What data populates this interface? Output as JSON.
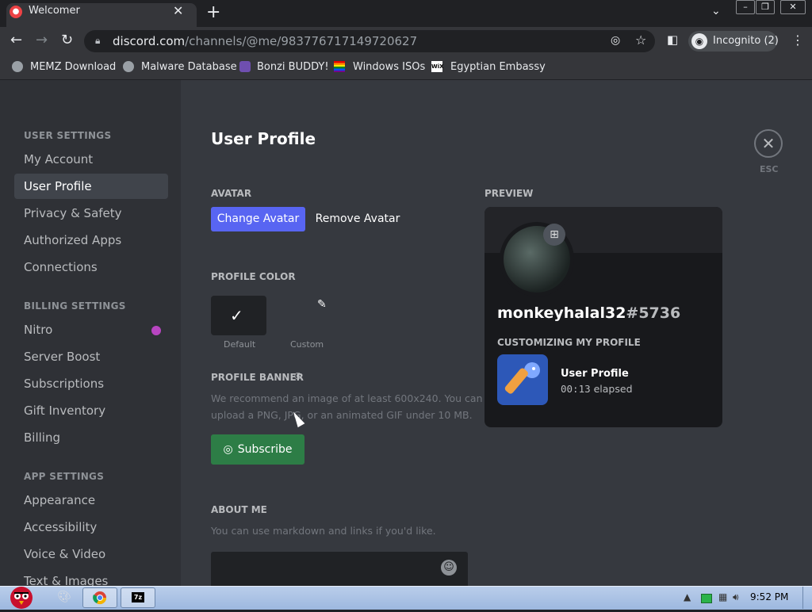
{
  "browser": {
    "tab_title": "Welcomer",
    "tab_close": "✕",
    "new_tab": "+",
    "url_host": "discord.com",
    "url_path": "/channels/@me/983776717149720627",
    "incognito_label": "Incognito (2)",
    "bookmarks": [
      {
        "label": "MEMZ Download",
        "icon": "globe-icon"
      },
      {
        "label": "Malware Database",
        "icon": "globe-icon"
      },
      {
        "label": "Bonzi BUDDY!",
        "icon": "bonzi-icon"
      },
      {
        "label": "Windows ISOs",
        "icon": "windows-flag-icon"
      },
      {
        "label": "Egyptian Embassy",
        "icon": "wix-icon"
      }
    ]
  },
  "sidebar": {
    "sections": [
      {
        "title": "USER SETTINGS",
        "items": [
          "My Account",
          "User Profile",
          "Privacy & Safety",
          "Authorized Apps",
          "Connections"
        ]
      },
      {
        "title": "BILLING SETTINGS",
        "items": [
          "Nitro",
          "Server Boost",
          "Subscriptions",
          "Gift Inventory",
          "Billing"
        ]
      },
      {
        "title": "APP SETTINGS",
        "items": [
          "Appearance",
          "Accessibility",
          "Voice & Video",
          "Text & Images"
        ]
      }
    ],
    "selected": "User Profile"
  },
  "main": {
    "title": "User Profile",
    "avatar_label": "AVATAR",
    "change_avatar": "Change Avatar",
    "remove_avatar": "Remove Avatar",
    "profile_color_label": "PROFILE COLOR",
    "color_default": "Default",
    "color_custom": "Custom",
    "banner_label": "PROFILE BANNER",
    "banner_desc_1": "We recommend an image of at least 600x240. You can",
    "banner_desc_2": "upload a PNG, JPG, or an animated GIF under 10 MB.",
    "subscribe": "Subscribe",
    "about_label": "ABOUT ME",
    "about_desc": "You can use markdown and links if you'd like.",
    "esc": "ESC"
  },
  "preview": {
    "label": "PREVIEW",
    "username": "monkeyhalal32",
    "discriminator": "#5736",
    "activity_title": "CUSTOMIZING MY PROFILE",
    "activity_name": "User Profile",
    "activity_time": "00:13",
    "activity_time_suffix": " elapsed"
  },
  "taskbar": {
    "clock": "9:52 PM",
    "apps": [
      "paint-icon",
      "chrome-icon",
      "7zip-icon"
    ]
  },
  "colors": {
    "blurple": "#5865f2",
    "nitro_green": "#2d7d46",
    "sidebar_bg": "#2f3136",
    "content_bg": "#36393f"
  }
}
